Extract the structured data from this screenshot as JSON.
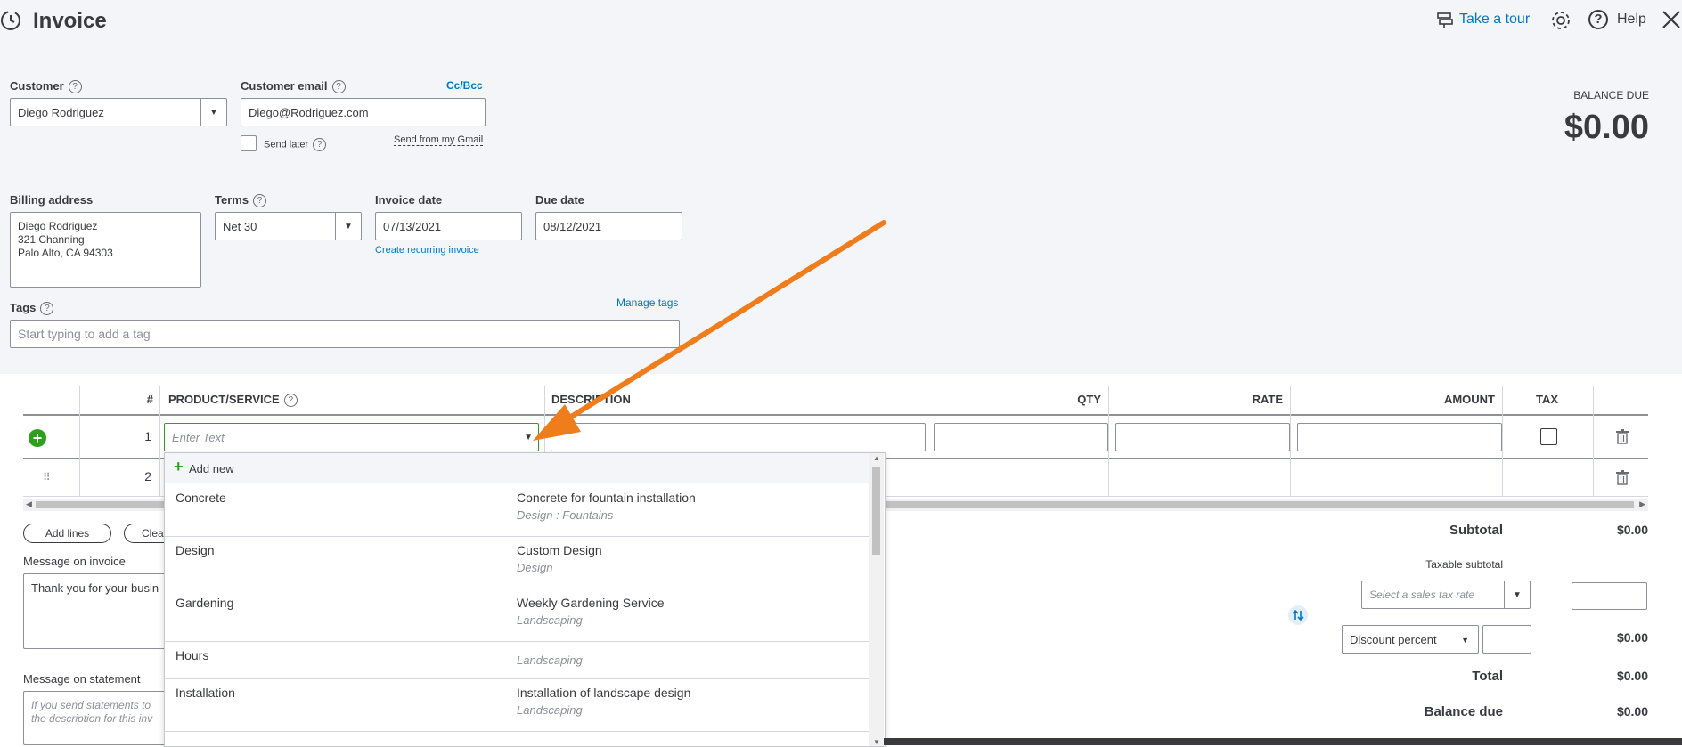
{
  "header": {
    "title": "Invoice",
    "tour": "Take a tour",
    "help": "Help"
  },
  "customer": {
    "label": "Customer",
    "value": "Diego Rodriguez"
  },
  "email": {
    "label": "Customer email",
    "value": "Diego@Rodriguez.com",
    "cc": "Cc/Bcc",
    "send_later": "Send later",
    "gmail": "Send from my Gmail"
  },
  "balance": {
    "label": "BALANCE DUE",
    "amount": "$0.00"
  },
  "billing": {
    "label": "Billing address",
    "lines": [
      "Diego Rodriguez",
      "321 Channing",
      "Palo Alto, CA  94303"
    ]
  },
  "terms": {
    "label": "Terms",
    "value": "Net 30"
  },
  "invoice_date": {
    "label": "Invoice date",
    "value": "07/13/2021",
    "recurring": "Create recurring invoice"
  },
  "due_date": {
    "label": "Due date",
    "value": "08/12/2021"
  },
  "tags": {
    "label": "Tags",
    "manage": "Manage tags",
    "placeholder": "Start typing to add a tag"
  },
  "table": {
    "headers": {
      "num": "#",
      "product": "PRODUCT/SERVICE",
      "description": "DESCRIPTION",
      "qty": "QTY",
      "rate": "RATE",
      "amount": "AMOUNT",
      "tax": "TAX"
    },
    "rows": [
      {
        "num": "1",
        "placeholder": "Enter Text"
      },
      {
        "num": "2"
      }
    ]
  },
  "buttons": {
    "add_lines": "Add lines",
    "clear": "Clea"
  },
  "message_invoice": {
    "label": "Message on invoice",
    "value": "Thank you for your busin"
  },
  "message_statement": {
    "label": "Message on statement",
    "placeholder_1": "If you send statements to",
    "placeholder_2": "the description for this inv"
  },
  "dropdown": {
    "add_new": "Add new",
    "items": [
      {
        "name": "Concrete",
        "desc": "Concrete for fountain installation",
        "sub": "Design : Fountains"
      },
      {
        "name": "Design",
        "desc": "Custom Design",
        "sub": "Design"
      },
      {
        "name": "Gardening",
        "desc": "Weekly Gardening Service",
        "sub": "Landscaping"
      },
      {
        "name": "Hours",
        "desc": "",
        "sub": "Landscaping"
      },
      {
        "name": "Installation",
        "desc": "Installation of landscape design",
        "sub": "Landscaping"
      }
    ]
  },
  "totals": {
    "subtotal_label": "Subtotal",
    "subtotal": "$0.00",
    "taxable_label": "Taxable subtotal",
    "tax_placeholder": "Select a sales tax rate",
    "discount_label": "Discount percent",
    "discount": "$0.00",
    "total_label": "Total",
    "total": "$0.00",
    "balance_due_label": "Balance due",
    "balance_due": "$0.00"
  },
  "colors": {
    "accent": "#0077c5",
    "green": "#2ca01c",
    "arrow": "#f07d1b",
    "background": "#f4f5f8"
  }
}
